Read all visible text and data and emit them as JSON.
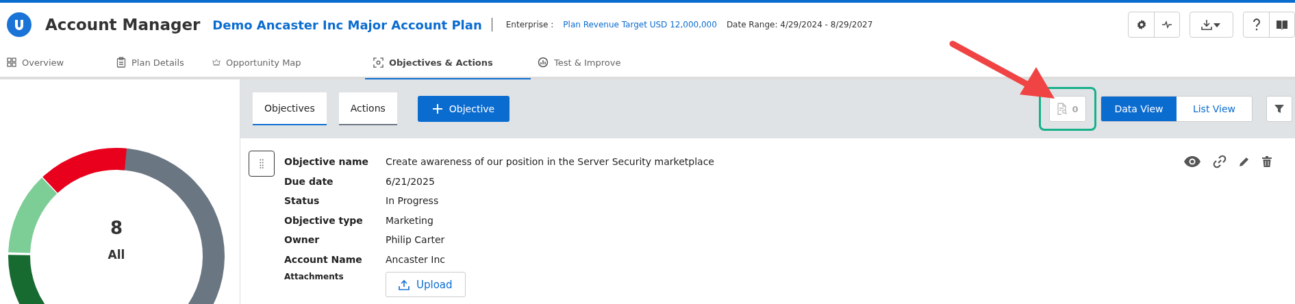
{
  "app": {
    "title": "Account Manager"
  },
  "plan": {
    "name": "Demo Ancaster Inc Major Account Plan",
    "enterprise_label": "Enterprise :",
    "revenue_target": "Plan Revenue Target USD 12,000,000",
    "date_range": "Date Range: 4/29/2024 - 8/29/2027"
  },
  "nav_tabs": [
    {
      "label": "Overview",
      "selected": false
    },
    {
      "label": "Plan Details",
      "selected": false
    },
    {
      "label": "Opportunity Map",
      "selected": false
    },
    {
      "label": "Objectives & Actions",
      "selected": true
    },
    {
      "label": "Test & Improve",
      "selected": false
    }
  ],
  "summary": {
    "count": "8",
    "label": "All"
  },
  "sub_tabs": [
    {
      "label": "Objectives",
      "selected": true
    },
    {
      "label": "Actions",
      "selected": false
    }
  ],
  "add_button": {
    "label": "Objective"
  },
  "search_count": "0",
  "view_toggle": [
    {
      "label": "Data View",
      "selected": true
    },
    {
      "label": "List View",
      "selected": false
    }
  ],
  "objective": {
    "fields": [
      {
        "label": "Objective name",
        "value": "Create awareness of our position in the Server Security marketplace"
      },
      {
        "label": "Due date",
        "value": "6/21/2025"
      },
      {
        "label": "Status",
        "value": "In Progress"
      },
      {
        "label": "Objective type",
        "value": "Marketing"
      },
      {
        "label": "Owner",
        "value": "Philip Carter"
      },
      {
        "label": "Account Name",
        "value": "Ancaster Inc"
      }
    ],
    "attachments_label": "Attachments",
    "upload_label": "Upload"
  }
}
